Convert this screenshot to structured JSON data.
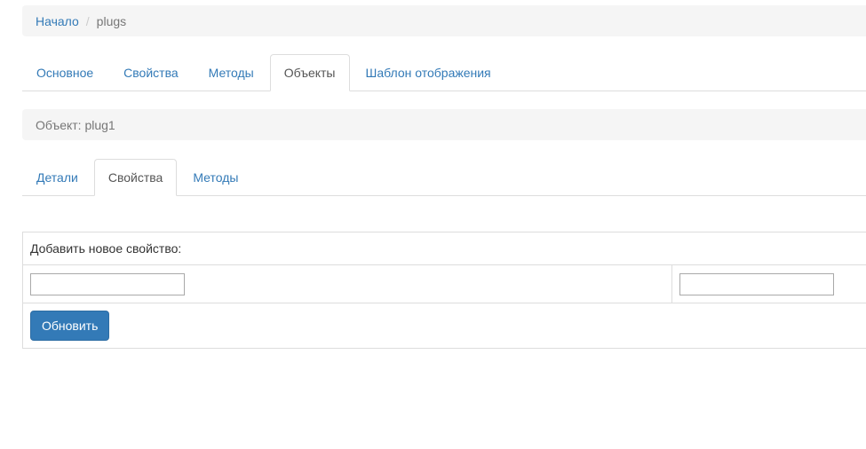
{
  "breadcrumb": {
    "home_label": "Начало",
    "separator": "/",
    "current_label": "plugs"
  },
  "main_tabs": [
    {
      "label": "Основное",
      "active": false
    },
    {
      "label": "Свойства",
      "active": false
    },
    {
      "label": "Методы",
      "active": false
    },
    {
      "label": "Объекты",
      "active": true
    },
    {
      "label": "Шаблон отображения",
      "active": false
    }
  ],
  "object_bar": {
    "label": "Объект: plug1"
  },
  "sub_tabs": [
    {
      "label": "Детали",
      "active": false
    },
    {
      "label": "Свойства",
      "active": true
    },
    {
      "label": "Методы",
      "active": false
    }
  ],
  "property_form": {
    "heading": "Добавить новое свойство:",
    "name_value": "",
    "value_value": "",
    "submit_label": "Обновить"
  },
  "colors": {
    "link": "#337ab7",
    "primary_button": "#337ab7",
    "bar_background": "#f5f5f5",
    "border": "#dddddd"
  }
}
